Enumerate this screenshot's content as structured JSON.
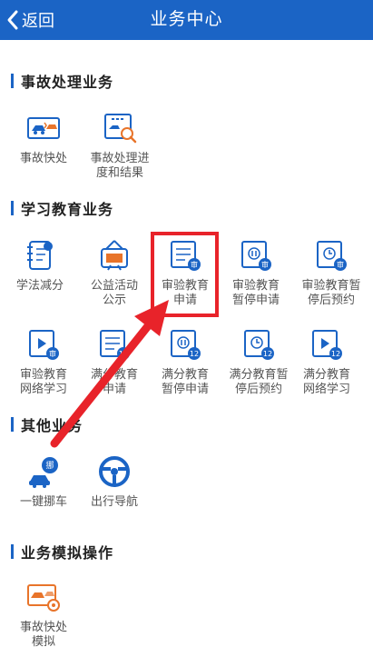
{
  "header": {
    "back_label": "返回",
    "title": "业务中心"
  },
  "sections": {
    "accident": {
      "title": "事故处理业务",
      "items": [
        "事故快处",
        "事故处理进\n度和结果"
      ]
    },
    "study": {
      "title": "学习教育业务",
      "items": [
        "学法减分",
        "公益活动\n公示",
        "审验教育\n申请",
        "审验教育\n暂停申请",
        "审验教育暂\n停后预约",
        "审验教育\n网络学习",
        "满分教育\n申请",
        "满分教育\n暂停申请",
        "满分教育暂\n停后预约",
        "满分教育\n网络学习"
      ]
    },
    "other": {
      "title": "其他业务",
      "items": [
        "一键挪车",
        "出行导航"
      ]
    },
    "sim": {
      "title": "业务模拟操作",
      "items": [
        "事故快处\n模拟"
      ]
    }
  },
  "icons": {
    "badge_shen": "审",
    "badge_12": "12",
    "badge_nuo": "挪"
  },
  "colors": {
    "brand": "#1b64c5",
    "highlight": "#e8232a",
    "accent_orange": "#e8742a"
  }
}
